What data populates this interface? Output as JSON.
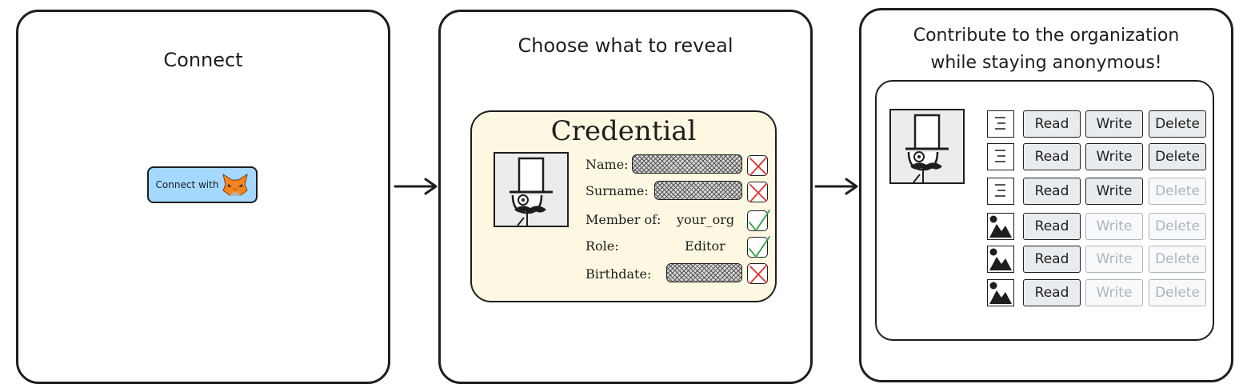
{
  "panels": {
    "connect": {
      "title": "Connect",
      "button_label": "Connect with",
      "button_icon": "metamask-fox-icon"
    },
    "reveal": {
      "title": "Choose what to reveal",
      "card_title": "Credential",
      "fields": [
        {
          "label": "Name:",
          "value": "",
          "revealed": false
        },
        {
          "label": "Surname:",
          "value": "",
          "revealed": false
        },
        {
          "label": "Member of:",
          "value": "your_org",
          "revealed": true
        },
        {
          "label": "Role:",
          "value": "Editor",
          "revealed": true
        },
        {
          "label": "Birthdate:",
          "value": "",
          "revealed": false
        }
      ]
    },
    "contribute": {
      "title_line1": "Contribute to the organization",
      "title_line2": "while staying anonymous!",
      "rows": [
        {
          "icon": "document-icon",
          "read": "Read",
          "write": "Write",
          "delete": "Delete",
          "read_enabled": true,
          "write_enabled": true,
          "delete_enabled": true
        },
        {
          "icon": "document-icon",
          "read": "Read",
          "write": "Write",
          "delete": "Delete",
          "read_enabled": true,
          "write_enabled": true,
          "delete_enabled": true
        },
        {
          "icon": "document-icon",
          "read": "Read",
          "write": "Write",
          "delete": "Delete",
          "read_enabled": true,
          "write_enabled": true,
          "delete_enabled": false
        },
        {
          "icon": "image-icon",
          "read": "Read",
          "write": "Write",
          "delete": "Delete",
          "read_enabled": true,
          "write_enabled": false,
          "delete_enabled": false
        },
        {
          "icon": "image-icon",
          "read": "Read",
          "write": "Write",
          "delete": "Delete",
          "read_enabled": true,
          "write_enabled": false,
          "delete_enabled": false
        },
        {
          "icon": "image-icon",
          "read": "Read",
          "write": "Write",
          "delete": "Delete",
          "read_enabled": true,
          "write_enabled": false,
          "delete_enabled": false
        }
      ]
    }
  },
  "colors": {
    "button": "#a5d8ff",
    "card": "#fdf8e1",
    "check_green": "#2f9e44",
    "cross_red": "#e03131",
    "disabled": "#adb5bd"
  }
}
